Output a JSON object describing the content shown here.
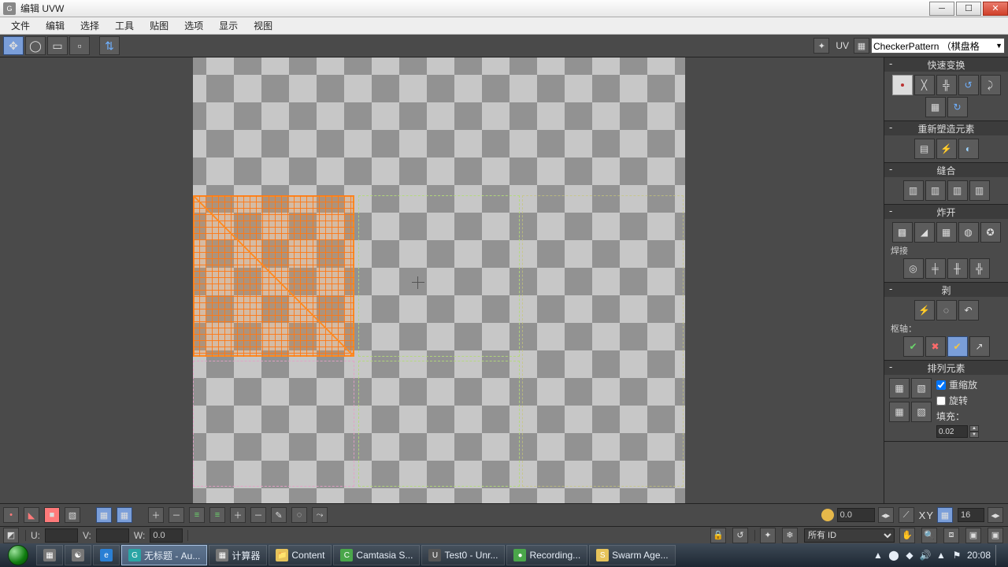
{
  "window": {
    "title": "编辑 UVW"
  },
  "menu": {
    "items": [
      "文件",
      "编辑",
      "选择",
      "工具",
      "贴图",
      "选项",
      "显示",
      "视图"
    ]
  },
  "topbar": {
    "uv_label": "UV",
    "texture_dropdown": "CheckerPattern  （棋盘格"
  },
  "right": {
    "quick_transform": {
      "title": "快速变换"
    },
    "reshape": {
      "title": "重新塑造元素"
    },
    "stitch": {
      "title": "缝合"
    },
    "explode": {
      "title": "炸开",
      "weld_label": "焊接"
    },
    "peel": {
      "title": "剥",
      "axis_label": "枢轴："
    },
    "arrange": {
      "title": "排列元素",
      "rescale": "重缩放",
      "rotate": "旋转",
      "pad_label": "填充：",
      "pad_value": "0.02"
    }
  },
  "bottombar": {
    "num_field": "0.0",
    "xy_label": "XY",
    "count_field": "16"
  },
  "statusbar": {
    "u_label": "U:",
    "v_label": "V:",
    "w_label": "W:",
    "w_value": "0.0",
    "id_dropdown": "所有 ID"
  },
  "taskbar": {
    "items": [
      {
        "label": "无标题 - Au..."
      },
      {
        "label": "计算器"
      },
      {
        "label": "Content"
      },
      {
        "label": "Camtasia S..."
      },
      {
        "label": "Test0 - Unr..."
      },
      {
        "label": "Recording..."
      },
      {
        "label": "Swarm Age..."
      }
    ],
    "time": "20:08"
  }
}
